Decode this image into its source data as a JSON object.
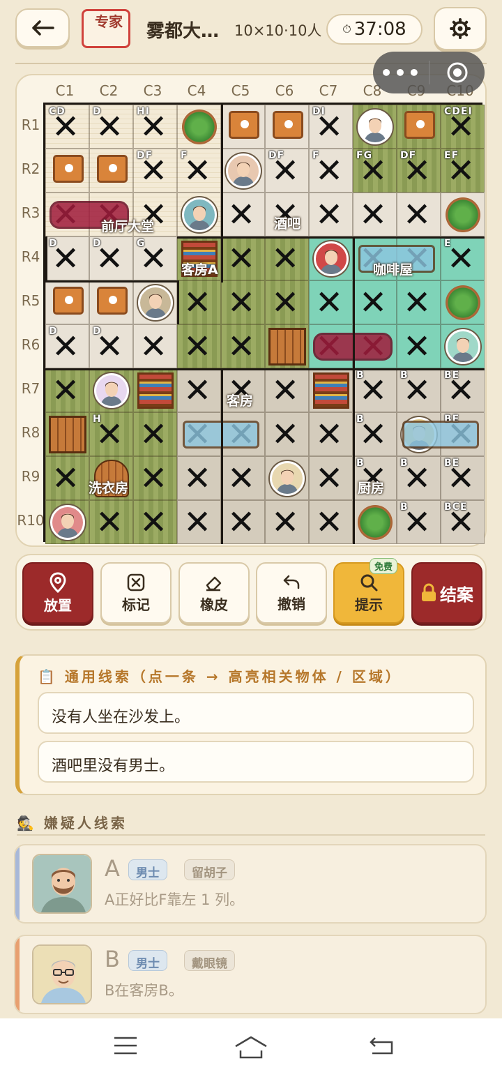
{
  "header": {
    "back_label": "←",
    "difficulty": "专家",
    "title": "雾都大…",
    "meta": "10×10·10人",
    "timer": "37:08",
    "timer_icon": "stopwatch-icon",
    "settings_icon": "gear-icon"
  },
  "capsule": {
    "more": "•••",
    "close_icon": "target-icon"
  },
  "board": {
    "columns": [
      "C1",
      "C2",
      "C3",
      "C4",
      "C5",
      "C6",
      "C7",
      "C8",
      "C9",
      "C10"
    ],
    "rows": [
      "R1",
      "R2",
      "R3",
      "R4",
      "R5",
      "R6",
      "R7",
      "R8",
      "R9",
      "R10"
    ],
    "room_labels": [
      {
        "text": "前厅大堂"
      },
      {
        "text": "酒吧"
      },
      {
        "text": "客房A"
      },
      {
        "text": "咖啡屋"
      },
      {
        "text": "客房"
      },
      {
        "text": "洗衣房"
      },
      {
        "text": "厨房"
      }
    ],
    "cells": [
      [
        "X:CD",
        "X:D",
        "X:HI",
        "plant",
        "table",
        "table",
        "X:DI",
        "avatar",
        "table",
        "X:CDEI"
      ],
      [
        "table",
        "table",
        "X:DF",
        "X:F",
        "avatar",
        "X:DF",
        "X:F",
        "X:FG",
        "X:DF",
        "X:EF"
      ],
      [
        "X",
        "X",
        "X",
        "avatar",
        "X",
        "X",
        "X",
        "X",
        "X",
        "plant"
      ],
      [
        "X:D",
        "X:D",
        "X:G",
        "shelf",
        "X",
        "X",
        "avatar",
        "X",
        "X",
        "X:E"
      ],
      [
        "table",
        "table",
        "avatar",
        "X",
        "X",
        "X",
        "X",
        "X",
        "X",
        "plant"
      ],
      [
        "X:D",
        "X:D",
        "X",
        "X",
        "X",
        "crate",
        "X",
        "X",
        "X",
        "avatar"
      ],
      [
        "X",
        "avatar",
        "shelf",
        "X",
        "X",
        "X",
        "shelf",
        "X:B",
        "X:B",
        "X:BE"
      ],
      [
        "crate",
        "X:H",
        "X",
        "X",
        "X",
        "X",
        "X",
        "X:B",
        "avatar",
        "X:BE"
      ],
      [
        "X",
        "barrel",
        "X",
        "X",
        "X",
        "avatar",
        "X",
        "X:B",
        "X:B",
        "X:BE"
      ],
      [
        "avatar",
        "X",
        "X",
        "X",
        "X",
        "X",
        "X",
        "plant",
        "X:B",
        "X:BCE"
      ]
    ]
  },
  "toolbar": {
    "place": "放置",
    "place_icon": "map-pin-icon",
    "mark": "标记",
    "mark_icon": "x-box-icon",
    "erase": "橡皮",
    "erase_icon": "eraser-icon",
    "undo": "撤销",
    "undo_icon": "undo-icon",
    "hint": "提示",
    "hint_icon": "search-icon",
    "hint_badge": "免费",
    "close_case": "结案",
    "close_icon": "lock-icon"
  },
  "general_clues": {
    "heading": "通用线索（点一条 → 高亮相关物体 / 区域）",
    "items": [
      "没有人坐在沙发上。",
      "酒吧里没有男士。"
    ]
  },
  "suspects": {
    "heading": "嫌疑人线索",
    "list": [
      {
        "letter": "A",
        "gender": "男士",
        "trait": "留胡子",
        "clue": "A正好比F靠左 1 列。",
        "accent": "#a8b8d8"
      },
      {
        "letter": "B",
        "gender": "男士",
        "trait": "戴眼镜",
        "clue": "B在客房B。",
        "accent": "#e8a070"
      }
    ]
  },
  "colors": {
    "accent_red": "#9c2a2a",
    "accent_gold": "#f0b73a",
    "bg": "#f2e9d4"
  }
}
